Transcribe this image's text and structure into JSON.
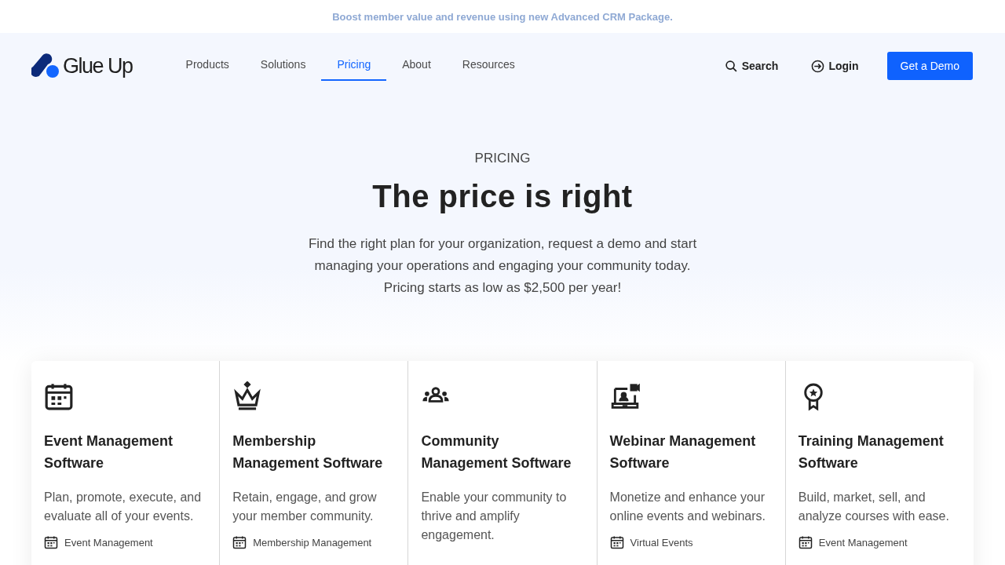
{
  "banner": {
    "text": "Boost member value and revenue using new Advanced CRM Package."
  },
  "header": {
    "logo": "Glue Up",
    "nav": [
      {
        "label": "Products",
        "selected": false
      },
      {
        "label": "Solutions",
        "selected": false
      },
      {
        "label": "Pricing",
        "selected": true
      },
      {
        "label": "About",
        "selected": false
      },
      {
        "label": "Resources",
        "selected": false
      }
    ],
    "search": "Search",
    "login": "Login",
    "cta": "Get a Demo"
  },
  "hero": {
    "eyebrow": "PRICING",
    "title": "The price is right",
    "lines": [
      "Find the right plan for your organization, request a demo and start",
      "managing your operations and engaging your community today.",
      "Pricing starts as low as $2,500 per year!"
    ]
  },
  "cards": [
    {
      "kind": "calendar",
      "title": "Event Management Software",
      "text": "Plan, promote, execute, and evaluate all of your events.",
      "tag": "Event Management"
    },
    {
      "kind": "crown",
      "title": "Membership Management Software",
      "text": "Retain, engage, and grow your member community.",
      "tag": "Membership Management"
    },
    {
      "kind": "people",
      "title": "Community Management Software",
      "text": "Enable your community to thrive and amplify engagement."
    },
    {
      "kind": "webinar",
      "title": "Webinar Management Software",
      "text": "Monetize and enhance your online events and webinars.",
      "tag": "Virtual Events"
    },
    {
      "kind": "award",
      "title": "Training Management Software",
      "text": "Build, market, sell, and analyze courses with ease.",
      "tag": "Event Management"
    }
  ]
}
